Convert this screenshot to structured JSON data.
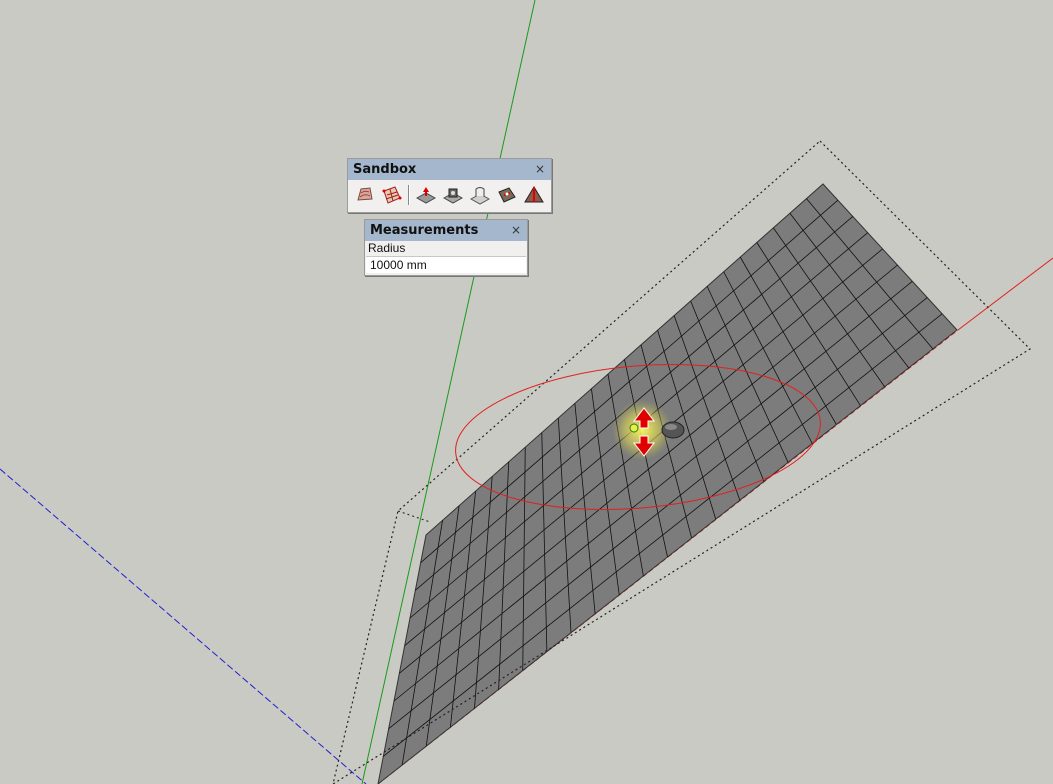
{
  "sandbox_toolbar": {
    "title": "Sandbox",
    "close": "×",
    "tools": [
      {
        "name": "from-contours-tool-icon"
      },
      {
        "name": "from-scratch-tool-icon"
      },
      {
        "name": "smoove-tool-icon"
      },
      {
        "name": "stamp-tool-icon"
      },
      {
        "name": "drape-tool-icon"
      },
      {
        "name": "add-detail-tool-icon"
      },
      {
        "name": "flip-edge-tool-icon"
      }
    ]
  },
  "measurements": {
    "title": "Measurements",
    "close": "×",
    "label": "Radius",
    "value": "10000 mm"
  },
  "colors": {
    "background": "#cacac4",
    "grid_face": "#7c7c7c",
    "grid_line": "#111111",
    "axis_red": "#e02020",
    "axis_green": "#1a9a1a",
    "axis_blue": "#2020d0",
    "panel_title": "#a4b7cd"
  }
}
